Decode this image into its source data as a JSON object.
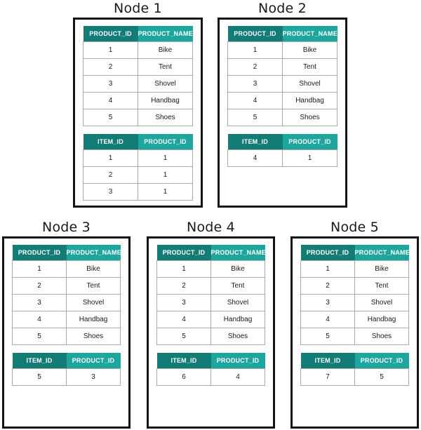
{
  "diagram": {
    "title_prefix": "Node",
    "colors": {
      "header_left": "#127d76",
      "header_right": "#1ca69d",
      "box_border": "#141414",
      "cell_border": "#a9a9a9",
      "text": "#1a1a1a",
      "header_text": "#ffffff",
      "background": "#ffffff"
    }
  },
  "nodes": [
    {
      "title": "Node 1",
      "product_table": {
        "headers": [
          "PRODUCT_ID",
          "PRODUCT_NAME"
        ],
        "rows": [
          [
            "1",
            "Bike"
          ],
          [
            "2",
            "Tent"
          ],
          [
            "3",
            "Shovel"
          ],
          [
            "4",
            "Handbag"
          ],
          [
            "5",
            "Shoes"
          ]
        ]
      },
      "item_table": {
        "headers": [
          "ITEM_ID",
          "PRODUCT_ID"
        ],
        "rows": [
          [
            "1",
            "1"
          ],
          [
            "2",
            "1"
          ],
          [
            "3",
            "1"
          ]
        ]
      }
    },
    {
      "title": "Node 2",
      "product_table": {
        "headers": [
          "PRODUCT_ID",
          "PRODUCT_NAME"
        ],
        "rows": [
          [
            "1",
            "Bike"
          ],
          [
            "2",
            "Tent"
          ],
          [
            "3",
            "Shovel"
          ],
          [
            "4",
            "Handbag"
          ],
          [
            "5",
            "Shoes"
          ]
        ]
      },
      "item_table": {
        "headers": [
          "ITEM_ID",
          "PRODUCT_ID"
        ],
        "rows": [
          [
            "4",
            "1"
          ]
        ]
      }
    },
    {
      "title": "Node 3",
      "product_table": {
        "headers": [
          "PRODUCT_ID",
          "PRODUCT_NAME"
        ],
        "rows": [
          [
            "1",
            "Bike"
          ],
          [
            "2",
            "Tent"
          ],
          [
            "3",
            "Shovel"
          ],
          [
            "4",
            "Handbag"
          ],
          [
            "5",
            "Shoes"
          ]
        ]
      },
      "item_table": {
        "headers": [
          "ITEM_ID",
          "PRODUCT_ID"
        ],
        "rows": [
          [
            "5",
            "3"
          ]
        ]
      }
    },
    {
      "title": "Node 4",
      "product_table": {
        "headers": [
          "PRODUCT_ID",
          "PRODUCT_NAME"
        ],
        "rows": [
          [
            "1",
            "Bike"
          ],
          [
            "2",
            "Tent"
          ],
          [
            "3",
            "Shovel"
          ],
          [
            "4",
            "Handbag"
          ],
          [
            "5",
            "Shoes"
          ]
        ]
      },
      "item_table": {
        "headers": [
          "ITEM_ID",
          "PRODUCT_ID"
        ],
        "rows": [
          [
            "6",
            "4"
          ]
        ]
      }
    },
    {
      "title": "Node 5",
      "product_table": {
        "headers": [
          "PRODUCT_ID",
          "PRODUCT_NAME"
        ],
        "rows": [
          [
            "1",
            "Bike"
          ],
          [
            "2",
            "Tent"
          ],
          [
            "3",
            "Shovel"
          ],
          [
            "4",
            "Handbag"
          ],
          [
            "5",
            "Shoes"
          ]
        ]
      },
      "item_table": {
        "headers": [
          "ITEM_ID",
          "PRODUCT_ID"
        ],
        "rows": [
          [
            "7",
            "5"
          ]
        ]
      }
    }
  ]
}
